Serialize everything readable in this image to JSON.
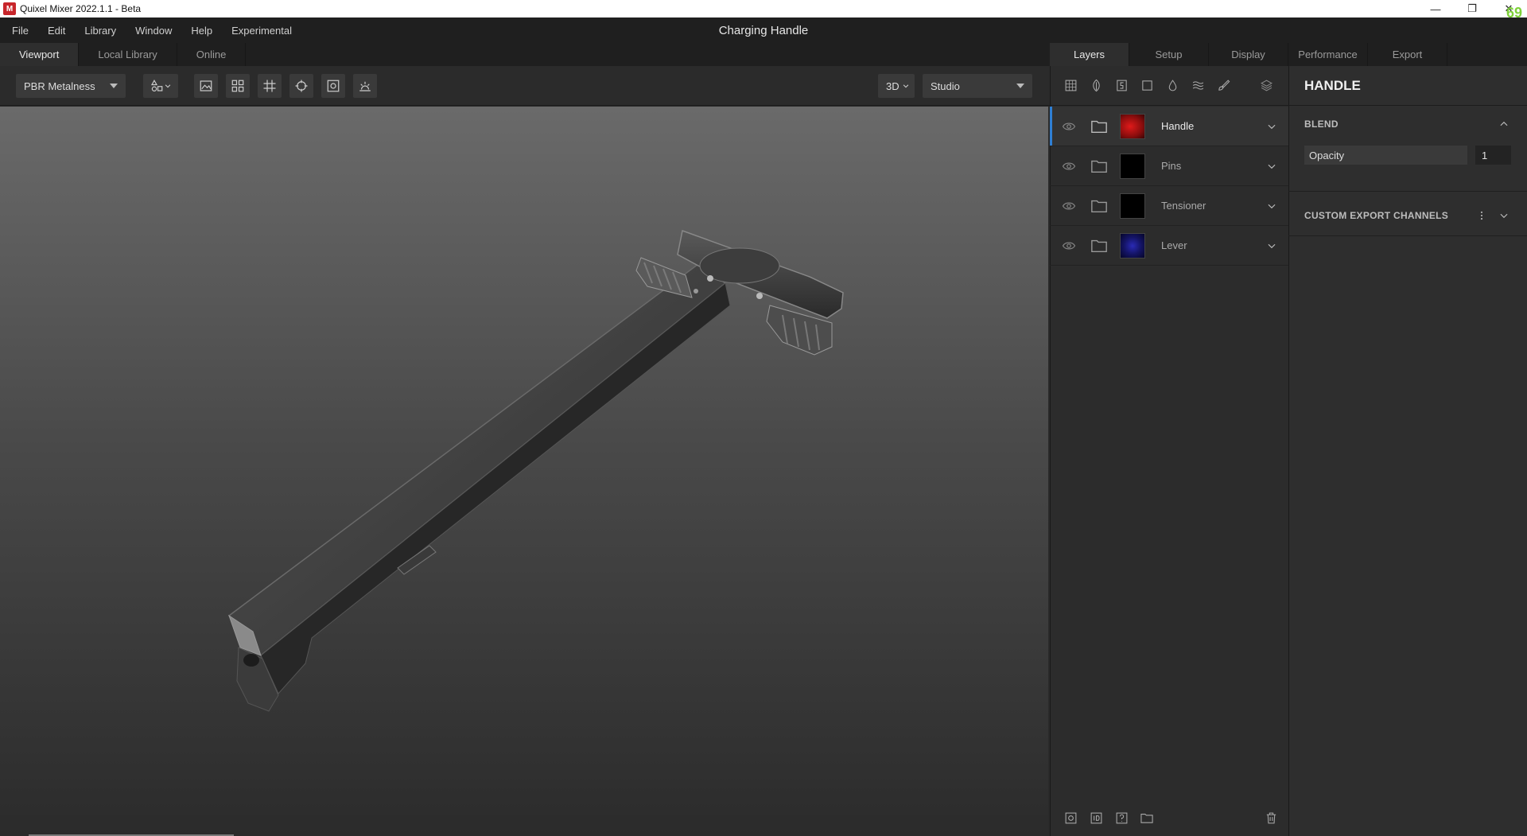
{
  "window": {
    "title": "Quixel Mixer 2022.1.1 - Beta",
    "logo_letter": "M",
    "fps": "69",
    "minimize_glyph": "—",
    "maximize_glyph": "❐",
    "close_glyph": "✕"
  },
  "menu": {
    "items": [
      "File",
      "Edit",
      "Library",
      "Window",
      "Help",
      "Experimental"
    ],
    "document_title": "Charging Handle"
  },
  "viewport_tabs": [
    "Viewport",
    "Local Library",
    "Online"
  ],
  "toolbar": {
    "material_mode": "PBR Metalness",
    "view_mode": "3D",
    "environment": "Studio",
    "icons": [
      "shapes-icon",
      "image-icon",
      "grid-4-icon",
      "grid-icon",
      "crosshair-icon",
      "frame-icon",
      "light-icon"
    ]
  },
  "right_tabs": [
    "Layers",
    "Setup",
    "Display",
    "Performance",
    "Export"
  ],
  "layer_tools": [
    "grid-layer-icon",
    "leaf-icon",
    "surface-icon",
    "square-icon",
    "drop-icon",
    "waves-icon",
    "brush-icon",
    "stack-icon"
  ],
  "layers": [
    {
      "name": "Handle",
      "thumb": "#b51515",
      "selected": true
    },
    {
      "name": "Pins",
      "thumb": "#000000",
      "selected": false
    },
    {
      "name": "Tensioner",
      "thumb": "#000000",
      "selected": false
    },
    {
      "name": "Lever",
      "thumb": "#1a1a8a",
      "selected": false
    }
  ],
  "properties": {
    "header": "HANDLE",
    "blend_title": "BLEND",
    "opacity_label": "Opacity",
    "opacity_value": "1",
    "custom_export_title": "CUSTOM EXPORT CHANNELS"
  },
  "colors": {
    "accent": "#2f7fd4",
    "fps": "#7fd13b",
    "logo": "#c8262b"
  }
}
